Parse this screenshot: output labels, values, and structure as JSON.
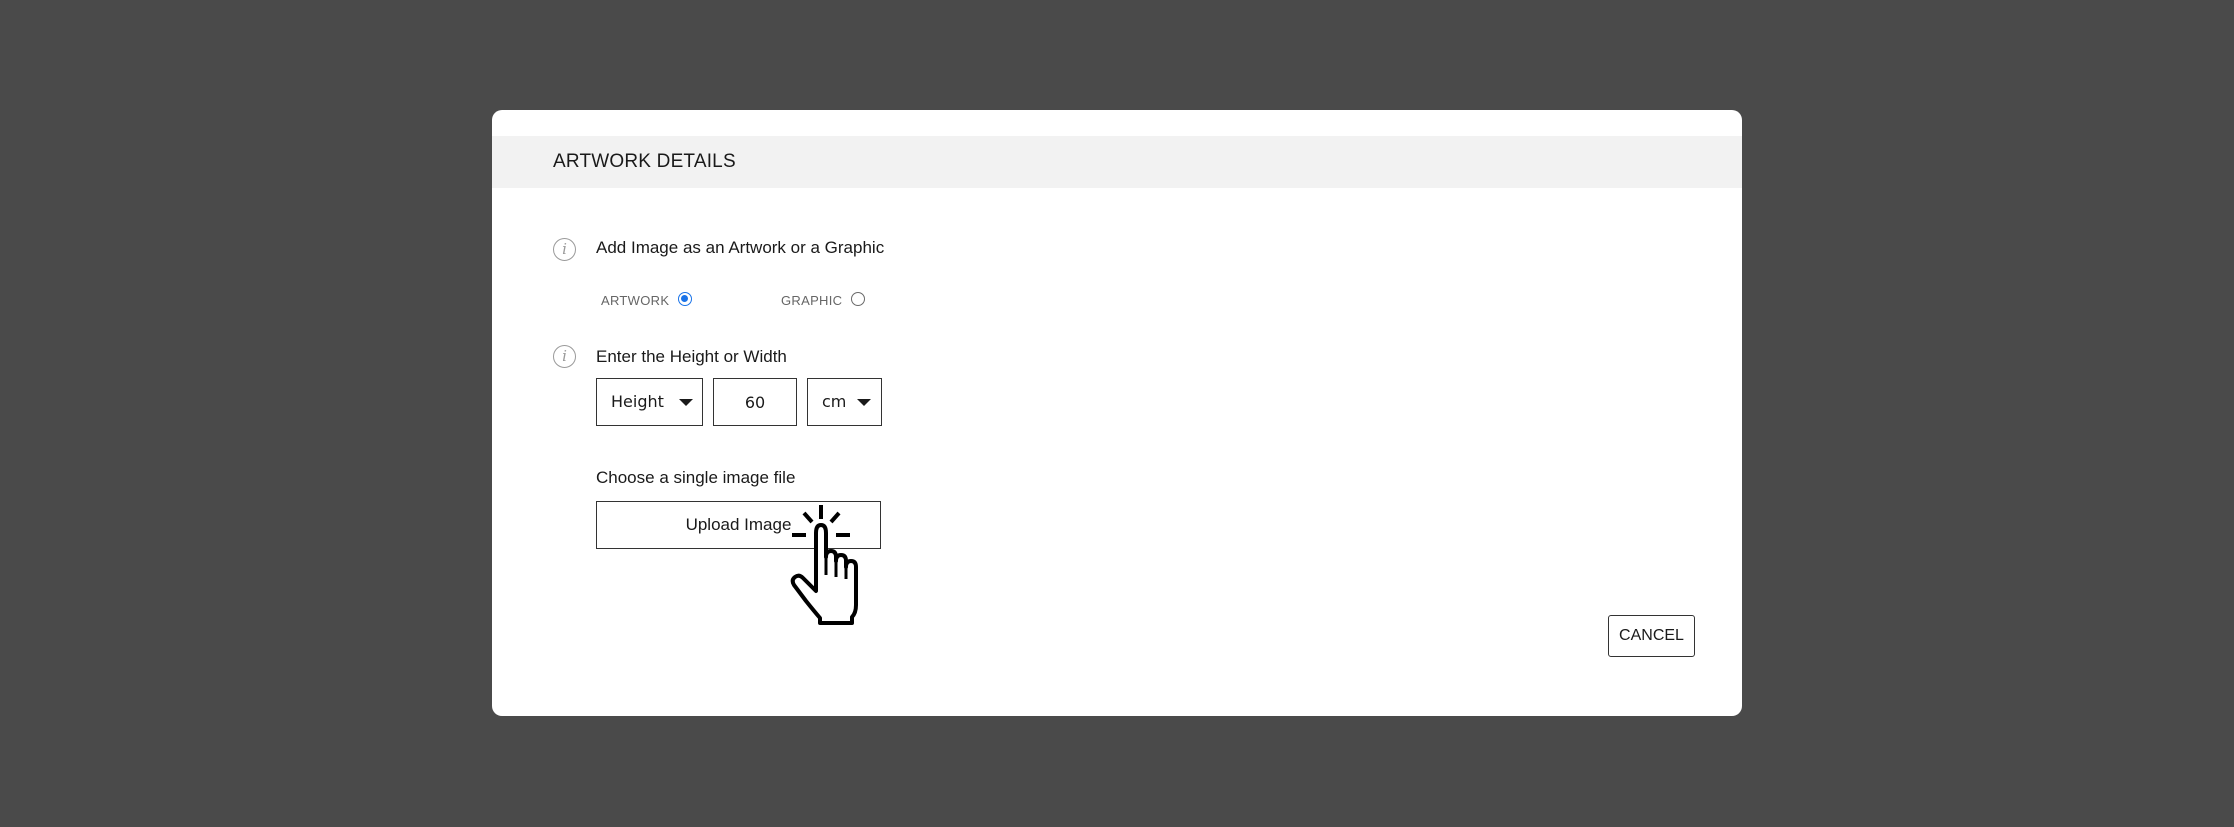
{
  "modal": {
    "title": "ARTWORK DETAILS"
  },
  "artwork_type": {
    "info_icon": "info-icon",
    "info_icon_glyph": "i",
    "prompt": "Add Image as an Artwork or a Graphic",
    "options": [
      {
        "label": "ARTWORK",
        "checked": true
      },
      {
        "label": "GRAPHIC",
        "checked": false
      }
    ]
  },
  "dimension": {
    "info_icon": "info-icon",
    "info_icon_glyph": "i",
    "prompt": "Enter the Height or Width",
    "measure_select": "Height",
    "value": "60",
    "unit_select": "cm"
  },
  "upload": {
    "prompt": "Choose a single image file",
    "button_label": "Upload Image"
  },
  "actions": {
    "cancel_label": "CANCEL"
  },
  "cursor": {
    "icon": "hand-pointer-click-icon"
  },
  "colors": {
    "backdrop": "#4a4a4a",
    "header_bg": "#f2f2f2",
    "radio_accent": "#1a73e8"
  }
}
